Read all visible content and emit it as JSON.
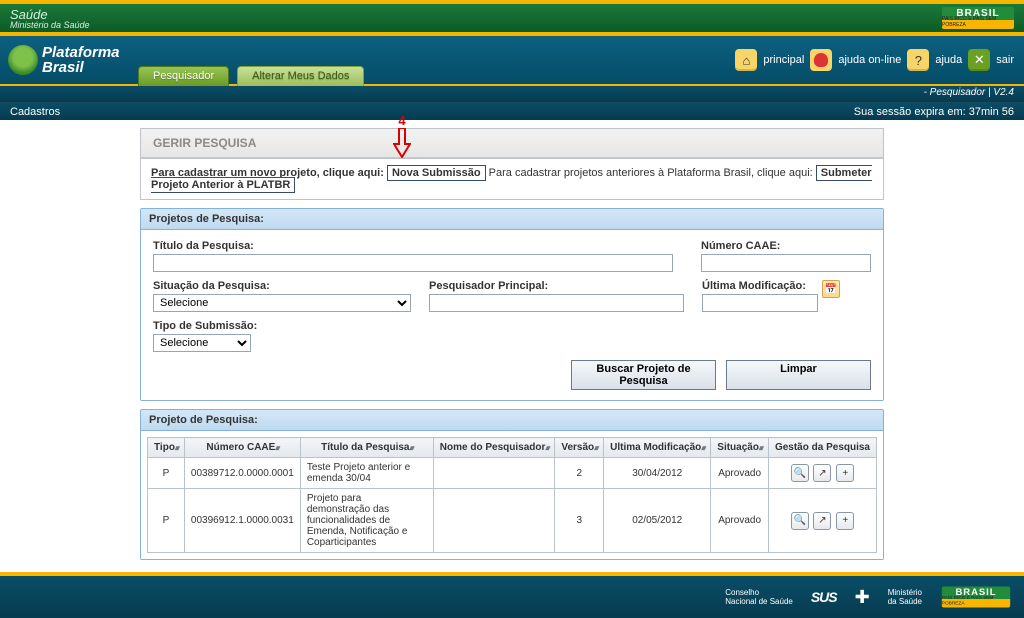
{
  "brand": {
    "flag_text": "BRASIL",
    "flag_sub": "PAÍS RICO É PAÍS SEM POBREZA"
  },
  "top_header": {
    "saude": "Saúde",
    "ministerio": "Ministério da Saúde"
  },
  "logo": {
    "line1": "Plataforma",
    "line2": "Brasil"
  },
  "topnav": {
    "principal": "principal",
    "ajuda_online": "ajuda on-line",
    "ajuda": "ajuda",
    "sair": "sair"
  },
  "tabs": {
    "pesquisador": "Pesquisador",
    "alterar": "Alterar Meus Dados"
  },
  "role_line": "- Pesquisador   |   V2.4",
  "menu": {
    "cadastros": "Cadastros",
    "session": "Sua sessão expira em: 37min 56"
  },
  "panel_title": "GERIR PESQUISA",
  "annotation": "4",
  "submit_line": {
    "pre1": "Para cadastrar um novo projeto, clique aqui:",
    "btn1": "Nova Submissão",
    "pre2": "Para cadastrar projetos anteriores à Plataforma Brasil, clique aqui:",
    "btn2": "Submeter Projeto Anterior à PLATBR"
  },
  "search_section": {
    "header": "Projetos de Pesquisa:",
    "titulo_label": "Título da Pesquisa:",
    "caae_label": "Número CAAE:",
    "situacao_label": "Situação da Pesquisa:",
    "situacao_value": "Selecione",
    "pesquisador_label": "Pesquisador Principal:",
    "ultima_label": "Última Modificação:",
    "tipo_label": "Tipo de Submissão:",
    "tipo_value": "Selecione",
    "buscar": "Buscar Projeto de Pesquisa",
    "limpar": "Limpar"
  },
  "results_section": {
    "header": "Projeto de Pesquisa:",
    "headers": {
      "tipo": "Tipo",
      "caae": "Número CAAE",
      "titulo": "Título da Pesquisa",
      "nome": "Nome do Pesquisador",
      "versao": "Versão",
      "modif": "Ultima Modificação",
      "situacao": "Situação",
      "gestao": "Gestão da Pesquisa"
    },
    "rows": [
      {
        "tipo": "P",
        "caae": "00389712.0.0000.0001",
        "titulo": "Teste Projeto anterior e emenda 30/04",
        "nome": "",
        "versao": "2",
        "modif": "30/04/2012",
        "situacao": "Aprovado"
      },
      {
        "tipo": "P",
        "caae": "00396912.1.0000.0031",
        "titulo": "Projeto para demonstração das funcionalidades de Emenda, Notificação e Coparticipantes",
        "nome": "",
        "versao": "3",
        "modif": "02/05/2012",
        "situacao": "Aprovado"
      }
    ]
  },
  "footer": {
    "conselho": "Conselho\nNacional de Saúde",
    "sus": "SUS",
    "ministerio": "Ministério\nda Saúde"
  }
}
